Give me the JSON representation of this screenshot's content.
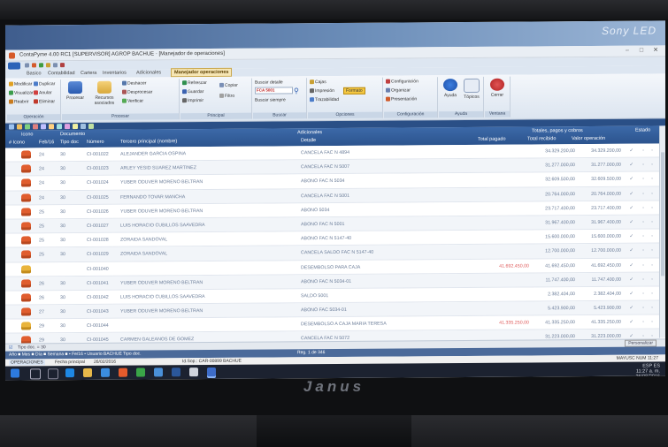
{
  "window": {
    "title": "ContaPyme 4.00 RC1 [SUPERVISOR] AGROP BACHUE · [Manejador de operaciones]",
    "controls": [
      "–",
      "□",
      "✕"
    ]
  },
  "ribbon": {
    "tabs": [
      "Basico",
      "Contabilidad",
      "Cartera",
      "Inventarios",
      "Adicionales",
      "Manejador operaciones"
    ],
    "groups": {
      "operacion": {
        "label": "Operación",
        "items": [
          "Modificar",
          "Duplicar",
          "Visualizar",
          "Anular",
          "Reabrir",
          "Eliminar"
        ]
      },
      "procesar": {
        "label": "Procesar",
        "big": "Procesar",
        "big2": "Recursos asociados",
        "items": [
          "Deshacer",
          "Desprocesar",
          "Verificar"
        ]
      },
      "principal": {
        "label": "Principal",
        "items": [
          "Refrescar",
          "Guardar",
          "Imprimir",
          "Copiar",
          "Filtro"
        ]
      },
      "buscar": {
        "label": "Buscar",
        "field_label": "Buscar detalle",
        "field_value": "FCA 5001",
        "subitem": "Buscar siempre"
      },
      "opciones": {
        "label": "Opciones",
        "items": [
          "Cajas",
          "Impresión",
          "Formato",
          "Trazabilidad"
        ],
        "highlight": "Formato"
      },
      "configuracion": {
        "label": "Configuración",
        "items": [
          "Configuración",
          "Organizar",
          "Presentación"
        ]
      },
      "ayuda": {
        "label": "Ayuda",
        "items": [
          "Ayuda",
          "Tópicos"
        ]
      },
      "ventana": {
        "label": "Ventana",
        "items": [
          "Cerrar"
        ]
      }
    }
  },
  "table": {
    "headers": {
      "icono": "Icono",
      "documento": "Documento",
      "adicionales": "Adicionales",
      "totales": "Totales, pagos y cobros",
      "estado": "Estado",
      "sub_itemno": "# Icono",
      "sub_fecha": "Feb/16",
      "sub_tipo": "Tipo doc",
      "sub_numero": "Número",
      "sub_tercero": "Tercero principal (nombre)",
      "sub_detalle": "Detalle",
      "sub_pagado": "Total pagado",
      "sub_recibido": "Total recibido",
      "sub_valor": "Valor operación"
    },
    "rows": [
      {
        "dia": "24",
        "tipo": "30",
        "numero": "CI-001022",
        "tercero": "ALEJANDER GARCIA OSPINA",
        "detalle": "CANCELA FAC N 4894",
        "pagado": "",
        "recibido": "34.329.200,00",
        "valor": "34.329.200,00",
        "icon": "truck"
      },
      {
        "dia": "24",
        "tipo": "30",
        "numero": "CI-001023",
        "tercero": "ARLEY YESID SUAREZ MARTINEZ",
        "detalle": "CANCELA FAC N 5007",
        "pagado": "",
        "recibido": "31.277.000,00",
        "valor": "31.277.000,00",
        "icon": "truck"
      },
      {
        "dia": "24",
        "tipo": "30",
        "numero": "CI-001024",
        "tercero": "YUBER ODUVER MORENO BELTRAN",
        "detalle": "ABONO FAC N 5034",
        "pagado": "",
        "recibido": "32.609.500,00",
        "valor": "32.609.500,00",
        "icon": "truck"
      },
      {
        "dia": "24",
        "tipo": "30",
        "numero": "CI-001025",
        "tercero": "FERNANDO TOVAR MANCHA",
        "detalle": "CANCELA FAC N 5001",
        "pagado": "",
        "recibido": "20.764.000,00",
        "valor": "20.764.000,00",
        "icon": "truck"
      },
      {
        "dia": "25",
        "tipo": "30",
        "numero": "CI-001026",
        "tercero": "YUBER ODUVER MORENO BELTRAN",
        "detalle": "ABONO 5034",
        "pagado": "",
        "recibido": "23.717.400,00",
        "valor": "23.717.400,00",
        "icon": "truck"
      },
      {
        "dia": "25",
        "tipo": "30",
        "numero": "CI-001027",
        "tercero": "LUIS HORACIO CUBILLOS SAAVEDRA",
        "detalle": "ABONO FAC N 5001",
        "pagado": "",
        "recibido": "31.967.400,00",
        "valor": "31.967.400,00",
        "icon": "truck"
      },
      {
        "dia": "25",
        "tipo": "30",
        "numero": "CI-001028",
        "tercero": "ZORAIDA SANDOVAL",
        "detalle": "ABONO FAC N 5147-40",
        "pagado": "",
        "recibido": "15.600.000,00",
        "valor": "15.600.000,00",
        "icon": "truck"
      },
      {
        "dia": "25",
        "tipo": "30",
        "numero": "CI-001029",
        "tercero": "ZORAIDA SANDOVAL",
        "detalle": "CANCELA SALDO FAC N 5147-40",
        "pagado": "",
        "recibido": "12.700.000,00",
        "valor": "12.700.000,00",
        "icon": "truck"
      },
      {
        "dia": "",
        "tipo": "",
        "numero": "CI-001040",
        "tercero": "",
        "detalle": "DESEMBOLSO PARA CAJA",
        "pagado": "41.692.450,00",
        "recibido": "41.692.450,00",
        "valor": "41.692.450,00",
        "icon": "bag"
      },
      {
        "dia": "26",
        "tipo": "30",
        "numero": "CI-001041",
        "tercero": "YUBER ODUVER MORENO BELTRAN",
        "detalle": "ABONO FAC N 5034-01",
        "pagado": "",
        "recibido": "11.747.400,00",
        "valor": "11.747.400,00",
        "icon": "truck"
      },
      {
        "dia": "26",
        "tipo": "30",
        "numero": "CI-001042",
        "tercero": "LUIS HORACIO CUBILLOS SAAVEDRA",
        "detalle": "SALDO 5001",
        "pagado": "",
        "recibido": "2.382.404,00",
        "valor": "2.382.404,00",
        "icon": "truck"
      },
      {
        "dia": "27",
        "tipo": "30",
        "numero": "CI-001043",
        "tercero": "YUBER ODUVER MORENO BELTRAN",
        "detalle": "ABONO FAC 5034-01",
        "pagado": "",
        "recibido": "5.423.900,00",
        "valor": "5.423.900,00",
        "icon": "truck"
      },
      {
        "dia": "29",
        "tipo": "30",
        "numero": "CI-001044",
        "tercero": "",
        "detalle": "DESEMBOLSO A CAJA MARIA TERESA",
        "pagado": "41.335.250,00",
        "recibido": "41.335.250,00",
        "valor": "41.335.250,00",
        "icon": "bag"
      },
      {
        "dia": "29",
        "tipo": "30",
        "numero": "CI-001045",
        "tercero": "CARMEN GALEANOS DE GOMEZ",
        "detalle": "CANCELA FAC N 5072",
        "pagado": "",
        "recibido": "31.223.000,00",
        "valor": "31.223.000,00",
        "icon": "truck"
      }
    ]
  },
  "status": {
    "filter_label": "Tipo doc. = 30",
    "nav_text": "Año ■ Mes ■ Día ■ Semana ■ • Fe/16 • Usuario BACHUE   Tipo doc.",
    "reg_text": "Reg. 1 de 346",
    "personalize": "Personalizar",
    "tab_mis": "OPERACIONES",
    "tab_fecha": "Fecha principal",
    "tab_date": "26/02/2016",
    "doc_id": "Id.Sop.: CAR-00899  BACHUE",
    "kbd": "MAYUSC  NUM  11:27"
  },
  "taskbar": {
    "time": "11:27 a. m.",
    "date": "26/08/2016",
    "lang": "ESP ES"
  },
  "desktop": {
    "brand_overlay": "Sony LED"
  },
  "monitor": {
    "brand": "Janus"
  }
}
